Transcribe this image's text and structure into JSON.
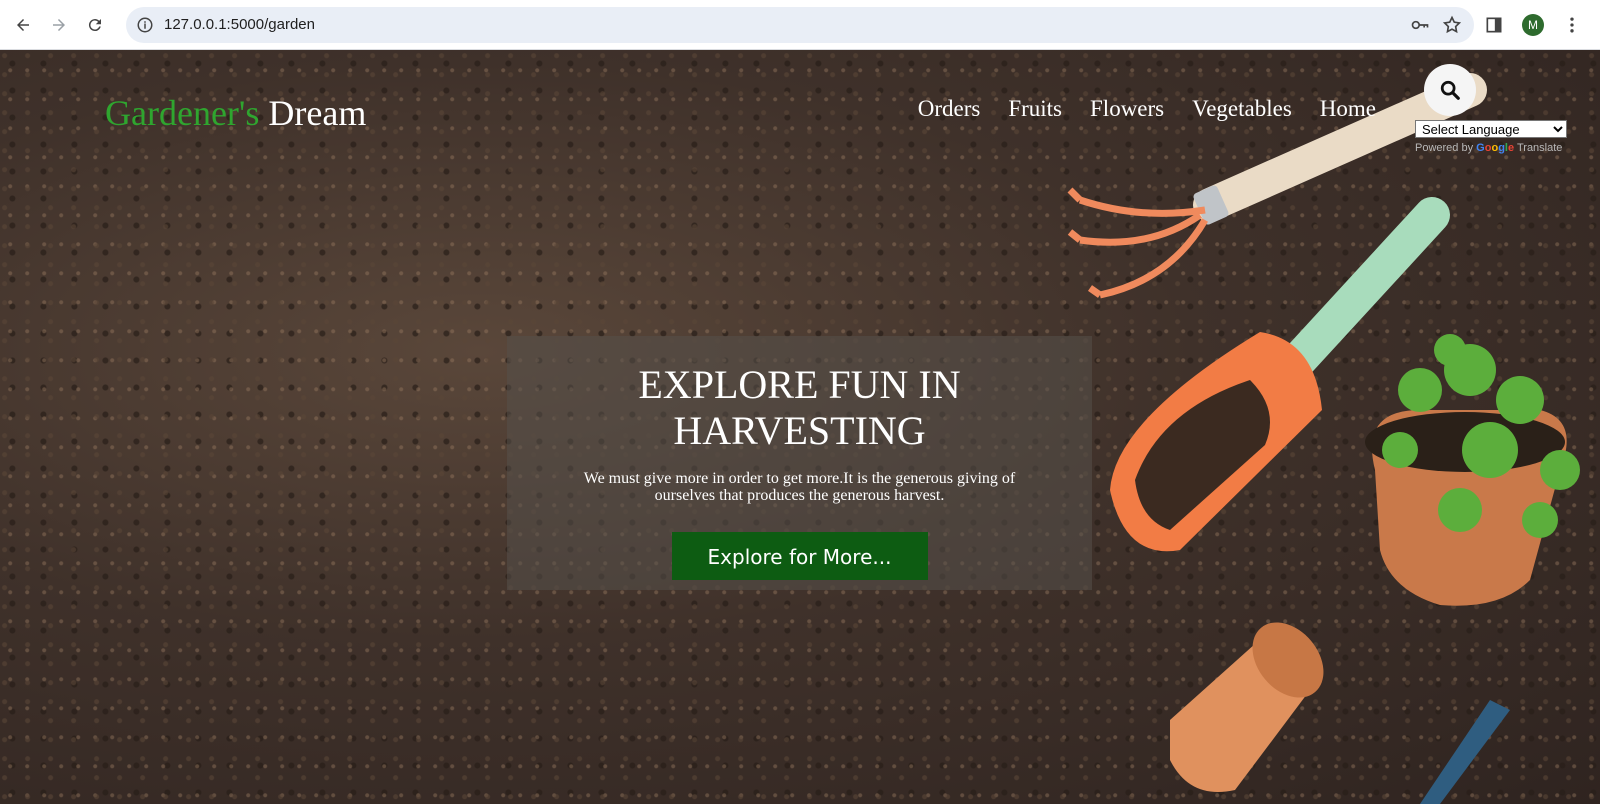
{
  "browser": {
    "url": "127.0.0.1:5000/garden",
    "profile_initial": "M",
    "icons": [
      "back-icon",
      "forward-icon",
      "reload-icon",
      "site-info-icon",
      "password-key-icon",
      "bookmark-star-icon",
      "side-panel-icon",
      "more-menu-icon"
    ]
  },
  "header": {
    "brand_part1": "Gardener's",
    "brand_part2": "Dream",
    "nav": [
      "Orders",
      "Fruits",
      "Flowers",
      "Vegetables",
      "Home"
    ],
    "search_icon": "search-icon"
  },
  "translate": {
    "select_value": "Select Language",
    "powered_prefix": "Powered by",
    "google": "Google",
    "suffix": "Translate"
  },
  "hero": {
    "title": "EXPLORE FUN IN HARVESTING",
    "text": "We must give more in order to get more.It is the generous giving of ourselves that produces the generous harvest.",
    "button": "Explore for More..."
  },
  "colors": {
    "brand_green": "#2fa52f",
    "button_green": "#0d5c12",
    "soil": "#3a2e28"
  }
}
